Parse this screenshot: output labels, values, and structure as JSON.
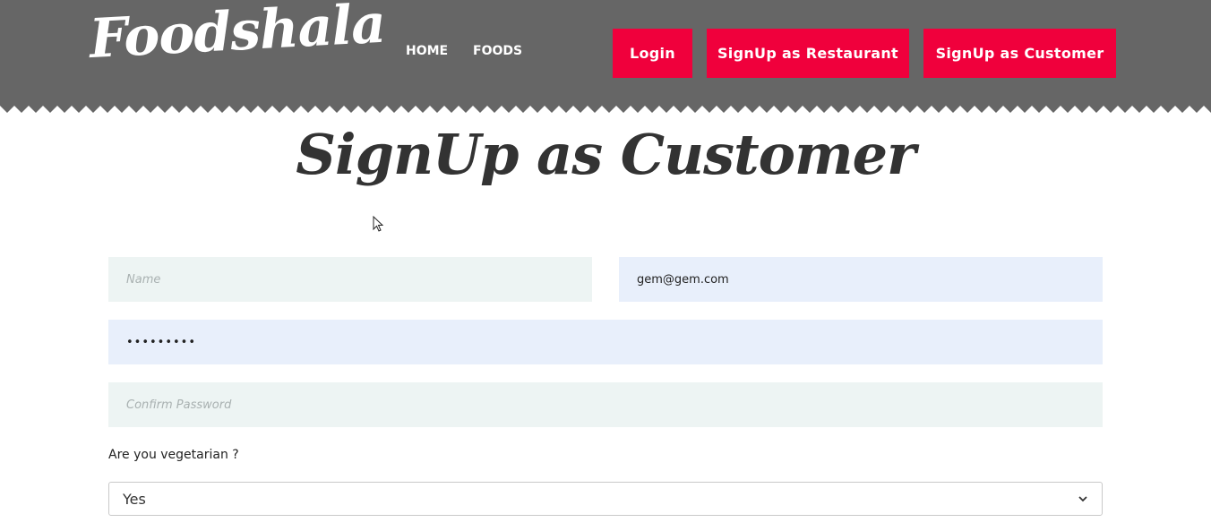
{
  "header": {
    "logo_text": "Foodshala",
    "nav": {
      "home": "HOME",
      "foods": "FOODS"
    },
    "buttons": {
      "login": "Login",
      "signup_restaurant": "SignUp as Restaurant",
      "signup_customer": "SignUp as Customer"
    }
  },
  "page": {
    "title": "SignUp as Customer"
  },
  "form": {
    "name": {
      "value": "",
      "placeholder": "Name"
    },
    "email": {
      "value": "gem@gem.com",
      "placeholder": ""
    },
    "password": {
      "value": "•••••••••",
      "placeholder": ""
    },
    "confirm_password": {
      "value": "",
      "placeholder": "Confirm Password"
    },
    "vegetarian_label": "Are you vegetarian ?",
    "vegetarian_selected": "Yes"
  },
  "colors": {
    "header_bg": "#666666",
    "accent": "#f0003c",
    "input_bg": "#edf4f3",
    "autofill_bg": "#e8effb"
  },
  "icons": {
    "cursor": "mouse-pointer-icon",
    "select_arrow": "chevron-down-icon"
  }
}
